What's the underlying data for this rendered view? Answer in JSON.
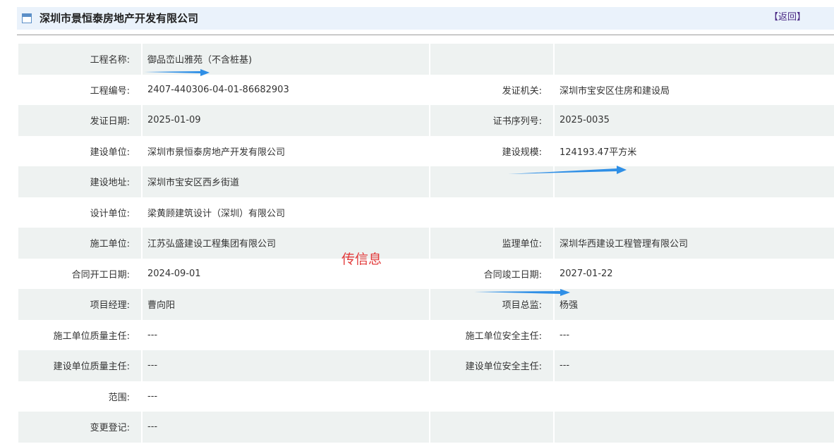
{
  "header": {
    "title": "深圳市景恒泰房地产开发有限公司",
    "back_label": "【返回】"
  },
  "overlay": {
    "text": "传信息"
  },
  "rows": [
    {
      "l1": "工程名称:",
      "v1": "御品峦山雅苑（不含桩基)",
      "l2": "",
      "v2": ""
    },
    {
      "l1": "工程编号:",
      "v1": "2407-440306-04-01-86682903",
      "l2": "发证机关:",
      "v2": "深圳市宝安区住房和建设局"
    },
    {
      "l1": "发证日期:",
      "v1": "2025-01-09",
      "l2": "证书序列号:",
      "v2": "2025-0035"
    },
    {
      "l1": "建设单位:",
      "v1": "深圳市景恒泰房地产开发有限公司",
      "l2": "建设规模:",
      "v2": "124193.47平方米"
    },
    {
      "l1": "建设地址:",
      "v1": "深圳市宝安区西乡街道",
      "l2": "",
      "v2": ""
    },
    {
      "l1": "设计单位:",
      "v1": "梁黄顾建筑设计（深圳）有限公司",
      "l2": "",
      "v2": ""
    },
    {
      "l1": "施工单位:",
      "v1": "江苏弘盛建设工程集团有限公司",
      "l2": "监理单位:",
      "v2": "深圳华西建设工程管理有限公司"
    },
    {
      "l1": "合同开工日期:",
      "v1": "2024-09-01",
      "l2": "合同竣工日期:",
      "v2": "2027-01-22"
    },
    {
      "l1": "项目经理:",
      "v1": "曹向阳",
      "l2": "项目总监:",
      "v2": "杨强"
    },
    {
      "l1": "施工单位质量主任:",
      "v1": "---",
      "l2": "施工单位安全主任:",
      "v2": "---"
    },
    {
      "l1": "建设单位质量主任:",
      "v1": "---",
      "l2": "建设单位安全主任:",
      "v2": "---"
    },
    {
      "l1": "范围:",
      "v1": "---",
      "l2": "",
      "v2": ""
    },
    {
      "l1": "变更登记:",
      "v1": "---",
      "l2": "",
      "v2": ""
    }
  ],
  "colors": {
    "arrow": "#2f8fe6",
    "overlay_text": "#e23a3a",
    "row_shade": "#eef2f1",
    "header_bg": "#eaf2fb"
  }
}
